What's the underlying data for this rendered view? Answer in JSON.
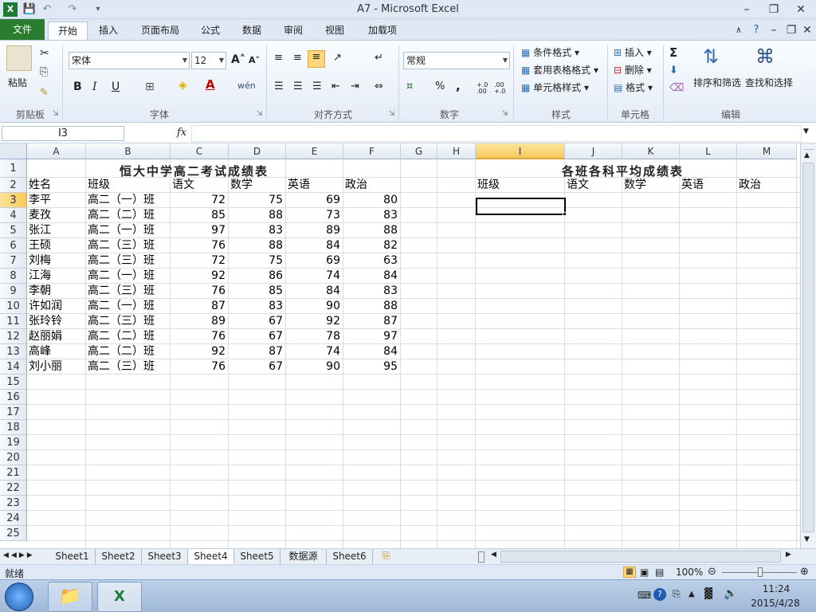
{
  "window": {
    "title": "A7  -  Microsoft Excel"
  },
  "tabs": {
    "file": "文件",
    "home": "开始",
    "insert": "插入",
    "layout": "页面布局",
    "formulas": "公式",
    "data": "数据",
    "review": "审阅",
    "view": "视图",
    "addins": "加载项"
  },
  "ribbon": {
    "clipboard": {
      "paste": "粘贴",
      "label": "剪贴板"
    },
    "font": {
      "name": "宋体",
      "size": "12",
      "label": "字体",
      "bold": "B",
      "italic": "I",
      "underline": "U",
      "wen": "wén"
    },
    "alignment": {
      "label": "对齐方式"
    },
    "number": {
      "format": "常规",
      "label": "数字",
      "percent": "%",
      "comma": ",",
      "inc_dec": "+.0 .00",
      "dec_dec": ".00 +.0"
    },
    "styles": {
      "conditional": "条件格式",
      "table": "套用表格格式",
      "cell": "单元格样式",
      "label": "样式"
    },
    "cells": {
      "insert": "插入",
      "delete": "删除",
      "format": "格式",
      "label": "单元格"
    },
    "editing": {
      "sort": "排序和筛选",
      "find": "查找和选择",
      "label": "编辑"
    }
  },
  "formula_bar": {
    "name_box": "I3",
    "fx": "fx",
    "value": ""
  },
  "columns": [
    "A",
    "B",
    "C",
    "D",
    "E",
    "F",
    "G",
    "H",
    "I",
    "J",
    "K",
    "L",
    "M"
  ],
  "rows": [
    "1",
    "2",
    "3",
    "4",
    "5",
    "6",
    "7",
    "8",
    "9",
    "10",
    "11",
    "12",
    "13",
    "14",
    "15",
    "16",
    "17",
    "18",
    "19",
    "20",
    "21",
    "22",
    "23",
    "24",
    "25"
  ],
  "sheet": {
    "title_left": "恒大中学高二考试成绩表",
    "title_right": "各班各科平均成绩表",
    "headers_left": [
      "姓名",
      "班级",
      "语文",
      "数学",
      "英语",
      "政治"
    ],
    "headers_right": [
      "班级",
      "语文",
      "数学",
      "英语",
      "政治"
    ],
    "records": [
      {
        "name": "李平",
        "class": "高二（一）班",
        "chinese": "72",
        "math": "75",
        "english": "69",
        "politics": "80"
      },
      {
        "name": "麦孜",
        "class": "高二（二）班",
        "chinese": "85",
        "math": "88",
        "english": "73",
        "politics": "83"
      },
      {
        "name": "张江",
        "class": "高二（一）班",
        "chinese": "97",
        "math": "83",
        "english": "89",
        "politics": "88"
      },
      {
        "name": "王硕",
        "class": "高二（三）班",
        "chinese": "76",
        "math": "88",
        "english": "84",
        "politics": "82"
      },
      {
        "name": "刘梅",
        "class": "高二（三）班",
        "chinese": "72",
        "math": "75",
        "english": "69",
        "politics": "63"
      },
      {
        "name": "江海",
        "class": "高二（一）班",
        "chinese": "92",
        "math": "86",
        "english": "74",
        "politics": "84"
      },
      {
        "name": "李朝",
        "class": "高二（三）班",
        "chinese": "76",
        "math": "85",
        "english": "84",
        "politics": "83"
      },
      {
        "name": "许如润",
        "class": "高二（一）班",
        "chinese": "87",
        "math": "83",
        "english": "90",
        "politics": "88"
      },
      {
        "name": "张玲铃",
        "class": "高二（三）班",
        "chinese": "89",
        "math": "67",
        "english": "92",
        "politics": "87"
      },
      {
        "name": "赵丽娟",
        "class": "高二（二）班",
        "chinese": "76",
        "math": "67",
        "english": "78",
        "politics": "97"
      },
      {
        "name": "高峰",
        "class": "高二（二）班",
        "chinese": "92",
        "math": "87",
        "english": "74",
        "politics": "84"
      },
      {
        "name": "刘小丽",
        "class": "高二（三）班",
        "chinese": "76",
        "math": "67",
        "english": "90",
        "politics": "95"
      }
    ]
  },
  "sheet_tabs": [
    "Sheet1",
    "Sheet2",
    "Sheet3",
    "Sheet4",
    "Sheet5",
    "数据源",
    "Sheet6"
  ],
  "status": {
    "ready": "就绪",
    "zoom": "100%"
  },
  "taskbar": {
    "time": "11:24",
    "date": "2015/4/28"
  },
  "colors": {
    "file_tab": "#2a7d2e",
    "ribbon_bg": "#e4ecf7",
    "selection": "#000000"
  }
}
